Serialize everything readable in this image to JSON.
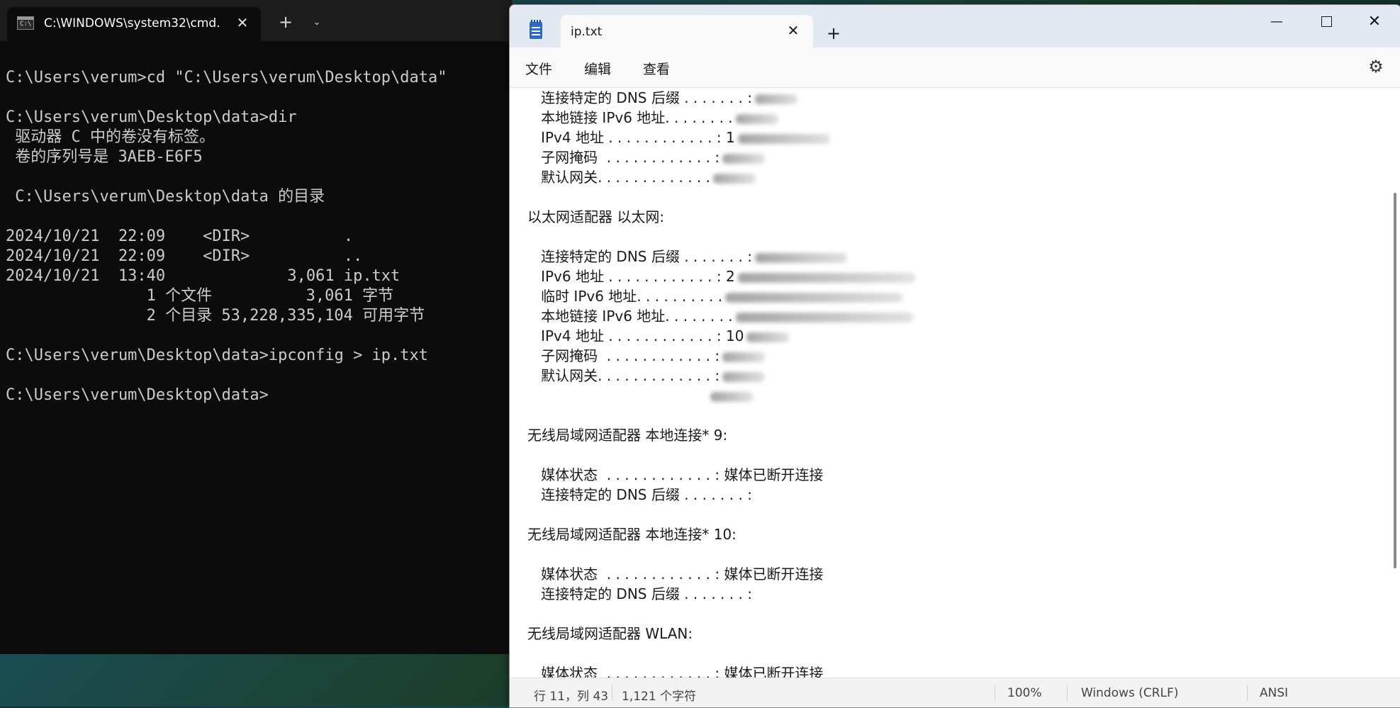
{
  "terminal": {
    "tab_title": "C:\\WINDOWS\\system32\\cmd.",
    "lines": [
      "C:\\Users\\verum>cd \"C:\\Users\\verum\\Desktop\\data\"",
      "",
      "C:\\Users\\verum\\Desktop\\data>dir",
      " 驱动器 C 中的卷没有标签。",
      " 卷的序列号是 3AEB-E6F5",
      "",
      " C:\\Users\\verum\\Desktop\\data 的目录",
      "",
      "2024/10/21  22:09    <DIR>          .",
      "2024/10/21  22:09    <DIR>          ..",
      "2024/10/21  13:40             3,061 ip.txt",
      "               1 个文件          3,061 字节",
      "               2 个目录 53,228,335,104 可用字节",
      "",
      "C:\\Users\\verum\\Desktop\\data>ipconfig > ip.txt",
      "",
      "C:\\Users\\verum\\Desktop\\data>"
    ]
  },
  "notepad": {
    "tab_title": "ip.txt",
    "menu": {
      "file": "文件",
      "edit": "编辑",
      "view": "查看"
    },
    "lines": [
      {
        "text": "   连接特定的 DNS 后缀 . . . . . . . :",
        "redacted": 1
      },
      {
        "text": "   本地链接 IPv6 地址. . . . . . . .",
        "redacted": 1
      },
      {
        "text": "   IPv4 地址 . . . . . . . . . . . . : 1",
        "redacted": 2
      },
      {
        "text": "   子网掩码  . . . . . . . . . . . . :",
        "redacted": 1
      },
      {
        "text": "   默认网关. . . . . . . . . . . . .",
        "redacted": 1
      },
      {
        "text": "",
        "redacted": 0
      },
      {
        "text": "以太网适配器 以太网:",
        "redacted": 0
      },
      {
        "text": "",
        "redacted": 0
      },
      {
        "text": "   连接特定的 DNS 后缀 . . . . . . . :",
        "redacted": 2
      },
      {
        "text": "   IPv6 地址 . . . . . . . . . . . . : 2",
        "redacted": 3
      },
      {
        "text": "   临时 IPv6 地址. . . . . . . . . .",
        "redacted": 3
      },
      {
        "text": "   本地链接 IPv6 地址. . . . . . . .",
        "redacted": 3
      },
      {
        "text": "   IPv4 地址 . . . . . . . . . . . . : 10",
        "redacted": 1
      },
      {
        "text": "   子网掩码  . . . . . . . . . . . . :",
        "redacted": 1
      },
      {
        "text": "   默认网关. . . . . . . . . . . . . :",
        "redacted": 1
      },
      {
        "text": "                                        ",
        "redacted": 1
      },
      {
        "text": "",
        "redacted": 0
      },
      {
        "text": "无线局域网适配器 本地连接* 9:",
        "redacted": 0
      },
      {
        "text": "",
        "redacted": 0
      },
      {
        "text": "   媒体状态  . . . . . . . . . . . . : 媒体已断开连接",
        "redacted": 0
      },
      {
        "text": "   连接特定的 DNS 后缀 . . . . . . . :",
        "redacted": 0
      },
      {
        "text": "",
        "redacted": 0
      },
      {
        "text": "无线局域网适配器 本地连接* 10:",
        "redacted": 0
      },
      {
        "text": "",
        "redacted": 0
      },
      {
        "text": "   媒体状态  . . . . . . . . . . . . : 媒体已断开连接",
        "redacted": 0
      },
      {
        "text": "   连接特定的 DNS 后缀 . . . . . . . :",
        "redacted": 0
      },
      {
        "text": "",
        "redacted": 0
      },
      {
        "text": "无线局域网适配器 WLAN:",
        "redacted": 0
      },
      {
        "text": "",
        "redacted": 0
      },
      {
        "text": "   媒体状态  . . . . . . . . . . . . : 媒体已断开连接",
        "redacted": 0
      }
    ],
    "status": {
      "position": "行 11，列 43",
      "chars": "1,121 个字符",
      "zoom": "100%",
      "eol": "Windows (CRLF)",
      "encoding": "ANSI"
    }
  }
}
